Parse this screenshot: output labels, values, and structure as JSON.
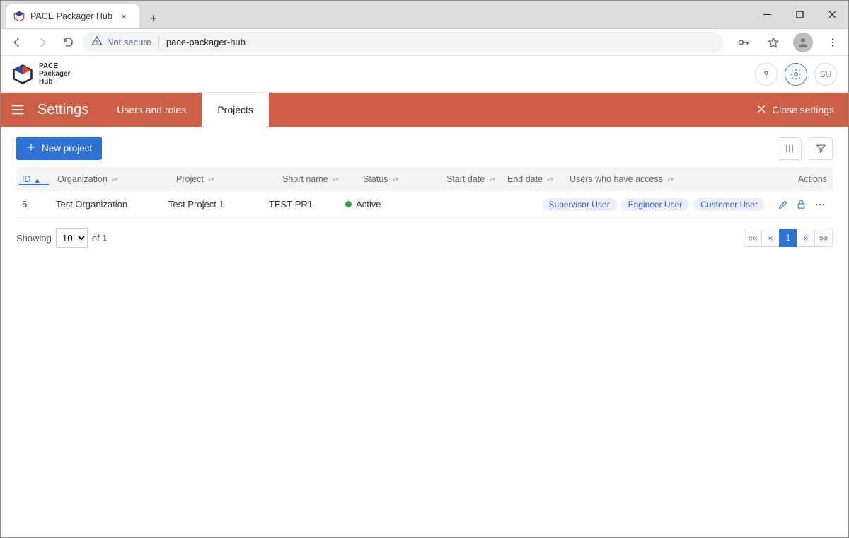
{
  "browser": {
    "tab_title": "PACE Packager Hub",
    "security_label": "Not secure",
    "url": "pace-packager-hub"
  },
  "app": {
    "logo_line1": "PACE",
    "logo_line2": "Packager",
    "logo_line3": "Hub",
    "user_initials": "SU"
  },
  "settings": {
    "title": "Settings",
    "tabs": {
      "users": "Users and roles",
      "projects": "Projects"
    },
    "close": "Close settings"
  },
  "toolbar": {
    "new_project": "New project"
  },
  "columns": {
    "id": "ID",
    "organization": "Organization",
    "project": "Project",
    "short_name": "Short name",
    "status": "Status",
    "start_date": "Start date",
    "end_date": "End date",
    "users": "Users who have access",
    "actions": "Actions"
  },
  "rows": [
    {
      "id": "6",
      "organization": "Test Organization",
      "project": "Test Project 1",
      "short_name": "TEST-PR1",
      "status": "Active",
      "start_date": "",
      "end_date": "",
      "users": [
        "Supervisor User",
        "Engineer User",
        "Customer User"
      ]
    }
  ],
  "footer": {
    "showing": "Showing",
    "of": "of",
    "total": "1",
    "page_size_options": [
      "10"
    ],
    "page_size_selected": "10"
  },
  "pager": {
    "first": "««",
    "prev": "«",
    "current": "1",
    "next": "»",
    "last": "»»"
  }
}
